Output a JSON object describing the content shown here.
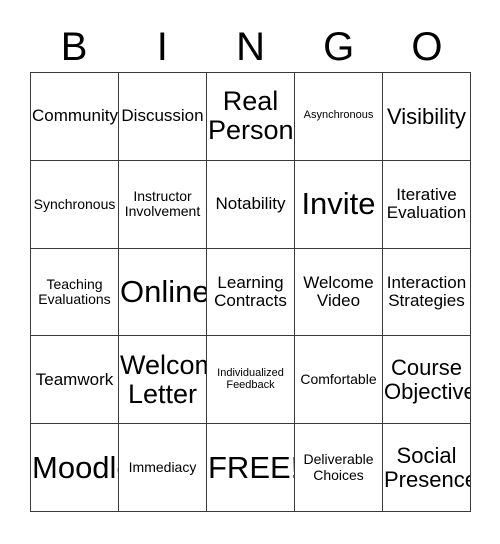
{
  "card": {
    "title": "BINGO Card",
    "header_letters": [
      "B",
      "I",
      "N",
      "G",
      "O"
    ],
    "free_space_label": "FREE!",
    "grid": {
      "columns": 5,
      "rows": 5,
      "border_color": "#3a3a3a",
      "background_color": "#ffffff",
      "text_color": "#000000"
    },
    "cells": [
      {
        "text": "Community",
        "size": "md"
      },
      {
        "text": "Discussion",
        "size": "md"
      },
      {
        "text": "Real\nPerson",
        "size": "xl"
      },
      {
        "text": "Asynchronous",
        "size": "xs"
      },
      {
        "text": "Visibility",
        "size": "lg"
      },
      {
        "text": "Synchronous",
        "size": "sm"
      },
      {
        "text": "Instructor\nInvolvement",
        "size": "sm"
      },
      {
        "text": "Notability",
        "size": "md"
      },
      {
        "text": "Invite",
        "size": "xxl"
      },
      {
        "text": "Iterative\nEvaluation",
        "size": "md"
      },
      {
        "text": "Teaching\nEvaluations",
        "size": "sm"
      },
      {
        "text": "Online",
        "size": "xxl"
      },
      {
        "text": "Learning\nContracts",
        "size": "md"
      },
      {
        "text": "Welcome\nVideo",
        "size": "md"
      },
      {
        "text": "Interaction\nStrategies",
        "size": "md"
      },
      {
        "text": "Teamwork",
        "size": "md"
      },
      {
        "text": "Welcome\nLetter",
        "size": "xl"
      },
      {
        "text": "Individualized\nFeedback",
        "size": "xs"
      },
      {
        "text": "Comfortable",
        "size": "sm"
      },
      {
        "text": "Course\nObjectives",
        "size": "lg"
      },
      {
        "text": "Moodle",
        "size": "xxl"
      },
      {
        "text": "Immediacy",
        "size": "sm"
      },
      {
        "text": "FREE!",
        "size": "xxl"
      },
      {
        "text": "Deliverable\nChoices",
        "size": "sm"
      },
      {
        "text": "Social\nPresence",
        "size": "lg"
      }
    ]
  }
}
